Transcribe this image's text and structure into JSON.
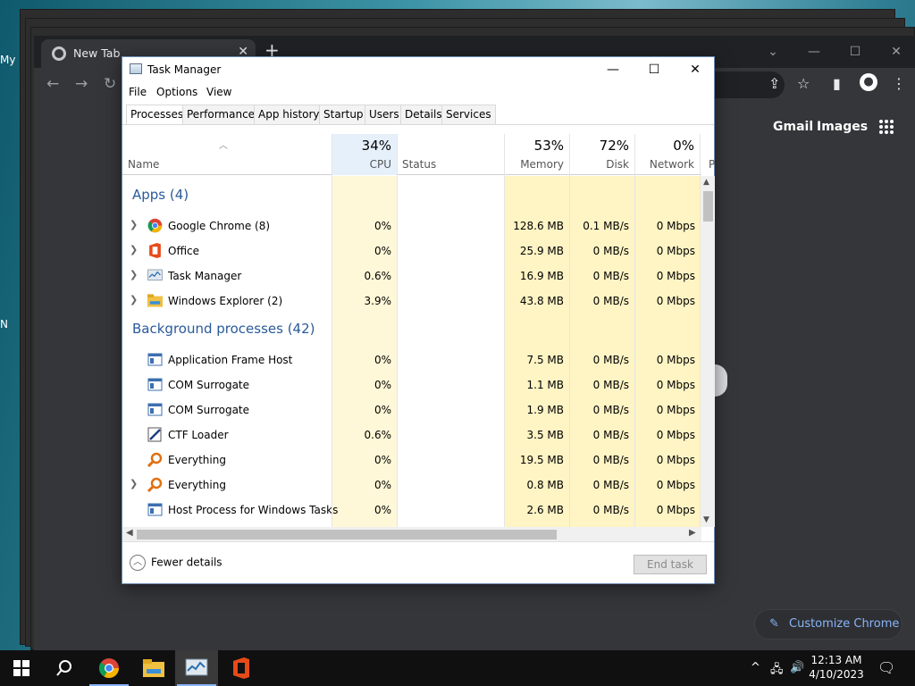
{
  "desktop": {
    "edge_labels": [
      "My",
      "N"
    ]
  },
  "chrome": {
    "tab_title": "New Tab",
    "tab_close": "✕",
    "new_tab": "+",
    "links": [
      "Gmail",
      "Images"
    ],
    "customize_label": "Customize Chrome",
    "controls": {
      "minimize": "—",
      "restore": "☐",
      "close": "✕",
      "dropdown": "⌄"
    },
    "nav": {
      "back": "←",
      "forward": "→",
      "reload": "↻"
    }
  },
  "task_manager": {
    "title": "Task Manager",
    "title_controls": {
      "minimize": "—",
      "maximize": "☐",
      "close": "✕"
    },
    "menu": [
      "File",
      "Options",
      "View"
    ],
    "tabs": [
      "Processes",
      "Performance",
      "App history",
      "Startup",
      "Users",
      "Details",
      "Services"
    ],
    "active_tab": "Processes",
    "columns": {
      "name": "Name",
      "cpu": {
        "pct": "34%",
        "label": "CPU"
      },
      "status": "Status",
      "memory": {
        "pct": "53%",
        "label": "Memory"
      },
      "disk": {
        "pct": "72%",
        "label": "Disk"
      },
      "network": {
        "pct": "0%",
        "label": "Network"
      },
      "power_partial": "P"
    },
    "groups": {
      "apps": "Apps (4)",
      "background": "Background processes (42)"
    },
    "apps": [
      {
        "name": "Google Chrome (8)",
        "cpu": "0%",
        "memory": "128.6 MB",
        "disk": "0.1 MB/s",
        "network": "0 Mbps",
        "expandable": true,
        "icon": "chrome-icon"
      },
      {
        "name": "Office",
        "cpu": "0%",
        "memory": "25.9 MB",
        "disk": "0 MB/s",
        "network": "0 Mbps",
        "expandable": true,
        "icon": "office-icon"
      },
      {
        "name": "Task Manager",
        "cpu": "0.6%",
        "memory": "16.9 MB",
        "disk": "0 MB/s",
        "network": "0 Mbps",
        "expandable": true,
        "icon": "task-manager-icon"
      },
      {
        "name": "Windows Explorer (2)",
        "cpu": "3.9%",
        "memory": "43.8 MB",
        "disk": "0 MB/s",
        "network": "0 Mbps",
        "expandable": true,
        "icon": "explorer-icon"
      }
    ],
    "background": [
      {
        "name": "Application Frame Host",
        "cpu": "0%",
        "memory": "7.5 MB",
        "disk": "0 MB/s",
        "network": "0 Mbps",
        "expandable": false,
        "icon": "window-icon"
      },
      {
        "name": "COM Surrogate",
        "cpu": "0%",
        "memory": "1.1 MB",
        "disk": "0 MB/s",
        "network": "0 Mbps",
        "expandable": false,
        "icon": "window-icon"
      },
      {
        "name": "COM Surrogate",
        "cpu": "0%",
        "memory": "1.9 MB",
        "disk": "0 MB/s",
        "network": "0 Mbps",
        "expandable": false,
        "icon": "window-icon"
      },
      {
        "name": "CTF Loader",
        "cpu": "0.6%",
        "memory": "3.5 MB",
        "disk": "0 MB/s",
        "network": "0 Mbps",
        "expandable": false,
        "icon": "ctf-loader-icon"
      },
      {
        "name": "Everything",
        "cpu": "0%",
        "memory": "19.5 MB",
        "disk": "0 MB/s",
        "network": "0 Mbps",
        "expandable": false,
        "icon": "everything-icon"
      },
      {
        "name": "Everything",
        "cpu": "0%",
        "memory": "0.8 MB",
        "disk": "0 MB/s",
        "network": "0 Mbps",
        "expandable": true,
        "icon": "everything-icon"
      },
      {
        "name": "Host Process for Windows Tasks",
        "cpu": "0%",
        "memory": "2.6 MB",
        "disk": "0 MB/s",
        "network": "0 Mbps",
        "expandable": false,
        "icon": "window-icon"
      }
    ],
    "fewer_details": "Fewer details",
    "end_task": "End task",
    "colors": {
      "cpu_col": "#e6f0fb",
      "heat_light": "#fff4c4",
      "heat_mid": "#ffe9a0",
      "group_text": "#2a5a9a"
    }
  },
  "taskbar": {
    "time": "12:13 AM",
    "date": "4/10/2023",
    "items": [
      "start-icon",
      "search-icon",
      "chrome-icon",
      "file-explorer-icon",
      "task-manager-icon",
      "office-icon"
    ],
    "tray": {
      "chevron": "^",
      "network": "🖧",
      "volume": "🔊",
      "lang": "",
      "notification": "🗨"
    }
  }
}
